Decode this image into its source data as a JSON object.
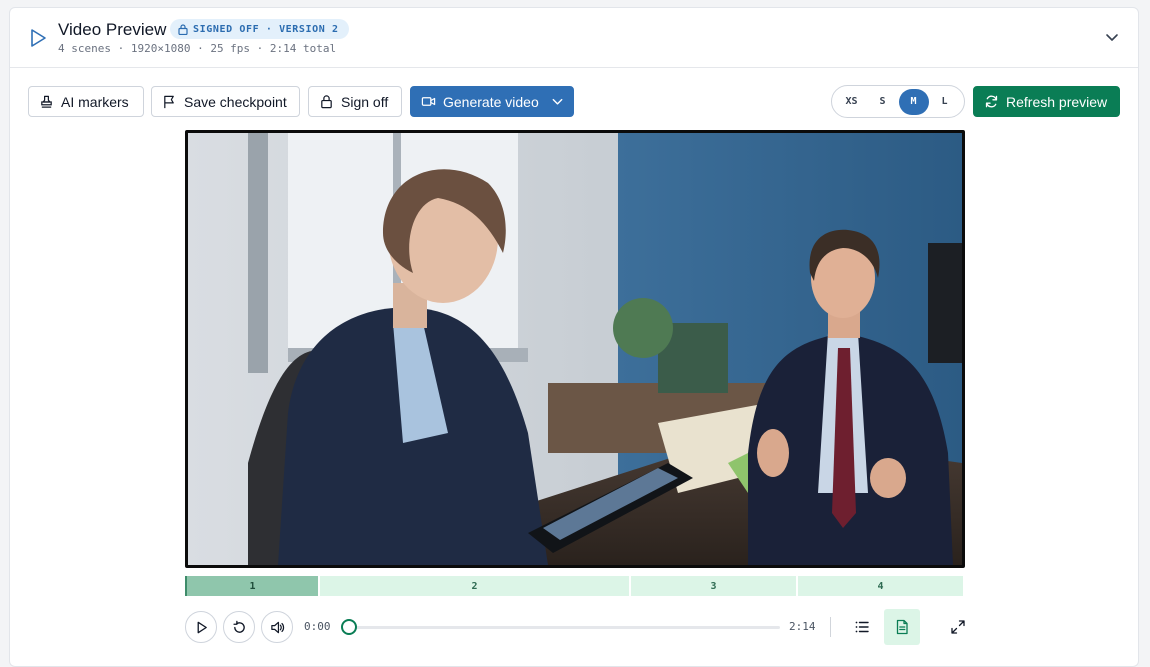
{
  "header": {
    "title": "Video Preview",
    "badge": "SIGNED OFF · VERSION 2",
    "meta": "4 scenes · 1920×1080 · 25 fps · 2:14 total"
  },
  "toolbar": {
    "ai_markers_label": "AI markers",
    "save_checkpoint_label": "Save checkpoint",
    "sign_off_label": "Sign off",
    "generate_video_label": "Generate video",
    "refresh_label": "Refresh preview",
    "sizes": [
      "XS",
      "S",
      "M",
      "L"
    ],
    "active_size": "M"
  },
  "scenes": [
    {
      "label": "1"
    },
    {
      "label": "2"
    },
    {
      "label": "3"
    },
    {
      "label": "4"
    }
  ],
  "player": {
    "current_time": "0:00",
    "total_time": "2:14",
    "progress_fraction": 0
  },
  "colors": {
    "primary": "#2f6fb5",
    "success": "#0a7d55",
    "scene_bg": "#dcf5e7",
    "scene_active": "#8fc6ac"
  },
  "icons": {
    "header": "play-outline-icon",
    "badge": "lock-icon",
    "collapse": "chevron-down-icon",
    "ai_markers": "stamp-icon",
    "save_checkpoint": "flag-icon",
    "sign_off": "lock-icon",
    "generate_video": "video-camera-icon",
    "refresh": "refresh-icon",
    "play": "play-icon",
    "restart": "rotate-ccw-icon",
    "volume": "volume-icon",
    "list": "list-icon",
    "transcript": "document-icon",
    "fullscreen": "fullscreen-icon"
  }
}
